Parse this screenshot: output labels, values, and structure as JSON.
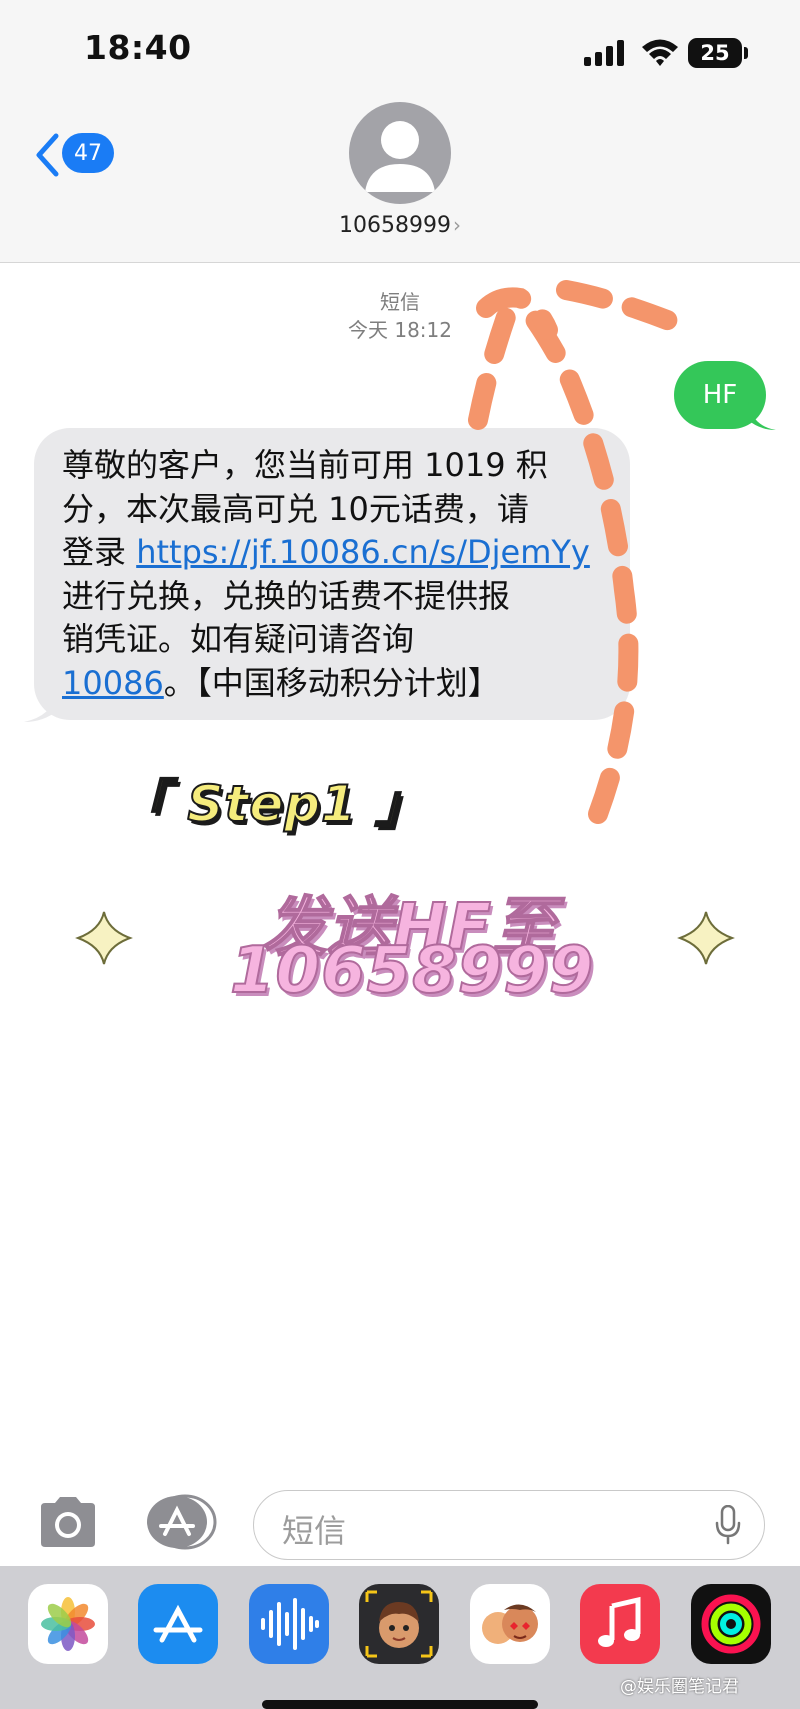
{
  "status_bar": {
    "time": "18:40",
    "battery": "25"
  },
  "header": {
    "back_count": "47",
    "contact": "10658999",
    "contact_chevron": "›"
  },
  "thread": {
    "message_type": "短信",
    "timestamp": "今天 18:12",
    "sent_message": "HF",
    "received": {
      "part1": "尊敬的客户，您当前可用 1019 积\n分，本次最高可兑 10元话费，请\n登录 ",
      "link1": "https://jf.10086.cn/s/DjemYy",
      "part2": "\n进行兑换，兑换的话费不提供报\n销凭证。如有疑问请咨询\n",
      "link2": "10086",
      "part3": "。【中国移动积分计划】"
    }
  },
  "overlay": {
    "step_label": "「 Step1 」",
    "promo_line1": "发送HF至",
    "promo_line2": "10658999"
  },
  "composer": {
    "placeholder": "短信"
  },
  "tray_apps": [
    "photos-icon",
    "app-store-icon",
    "audio-messages-icon",
    "memoji-icon",
    "memoji-stickers-icon",
    "music-icon",
    "fitness-icon"
  ],
  "watermark": "@娱乐圈笔记君",
  "colors": {
    "sent_bubble": "#34c759",
    "received_bubble": "#e9e9eb",
    "link": "#1a6fd2",
    "accent": "#1a7cf5"
  }
}
